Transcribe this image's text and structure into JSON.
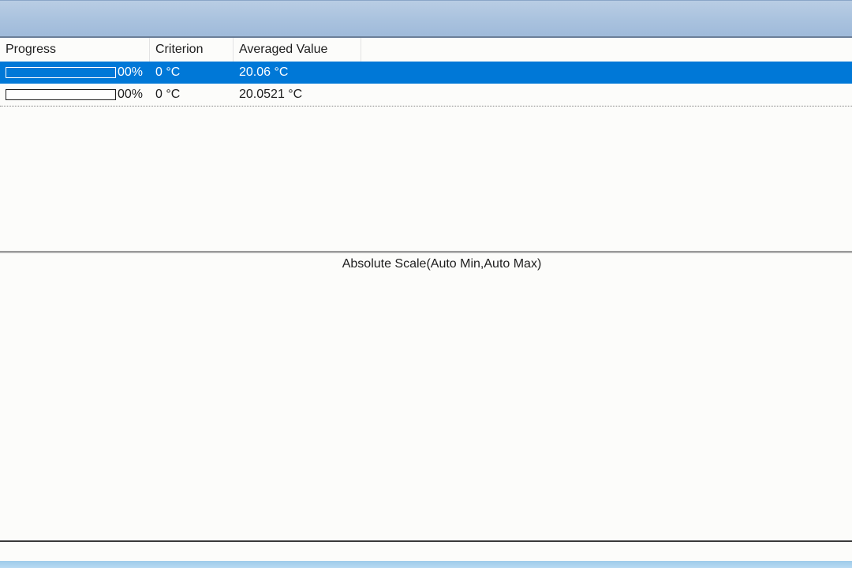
{
  "list": {
    "columns": [
      {
        "label": "Progress"
      },
      {
        "label": "Criterion"
      },
      {
        "label": "Averaged Value"
      }
    ],
    "rows": [
      {
        "progress_percent": 0,
        "progress_text": "00%",
        "criterion": "0 °C",
        "averaged_value": "20.06 °C",
        "selected": true
      },
      {
        "progress_percent": 0,
        "progress_text": "00%",
        "criterion": "0 °C",
        "averaged_value": "20.0521 °C",
        "selected": false
      }
    ]
  },
  "chart": {
    "title": "Absolute Scale(Auto Min,Auto Max)"
  },
  "colors": {
    "selection": "#0078d7",
    "title_bar": "#a9c2de"
  }
}
